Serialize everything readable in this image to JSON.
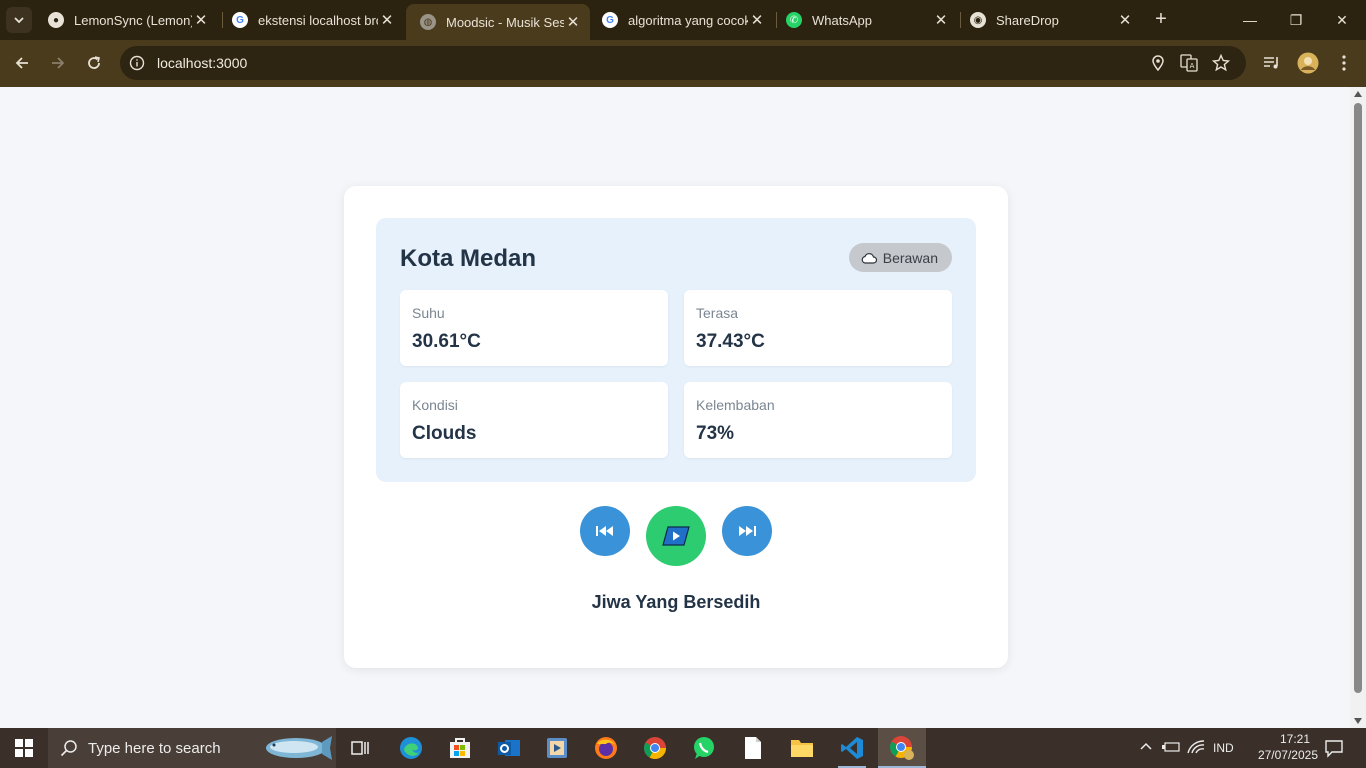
{
  "browser": {
    "tabs": [
      {
        "title": "LemonSync (Lemon)",
        "icon": "github-icon"
      },
      {
        "title": "ekstensi localhost bro",
        "icon": "google-icon"
      },
      {
        "title": "Moodsic - Musik Sesu",
        "icon": "globe-icon",
        "active": true
      },
      {
        "title": "algoritma yang cocok",
        "icon": "google-icon"
      },
      {
        "title": "WhatsApp",
        "icon": "whatsapp-icon"
      },
      {
        "title": "ShareDrop",
        "icon": "sharedrop-icon"
      }
    ],
    "url": "localhost:3000"
  },
  "weather": {
    "city": "Kota Medan",
    "badge": "Berawan",
    "stats": [
      {
        "label": "Suhu",
        "value": "30.61°C"
      },
      {
        "label": "Terasa",
        "value": "37.43°C"
      },
      {
        "label": "Kondisi",
        "value": "Clouds"
      },
      {
        "label": "Kelembaban",
        "value": "73%"
      }
    ]
  },
  "player": {
    "song_title": "Jiwa Yang Bersedih"
  },
  "taskbar": {
    "search_placeholder": "Type here to search",
    "language": "IND",
    "time": "17:21",
    "date": "27/07/2025"
  },
  "colors": {
    "accent_blue": "#3a93d8",
    "play_green": "#2ecc71",
    "text_dark": "#243447"
  }
}
